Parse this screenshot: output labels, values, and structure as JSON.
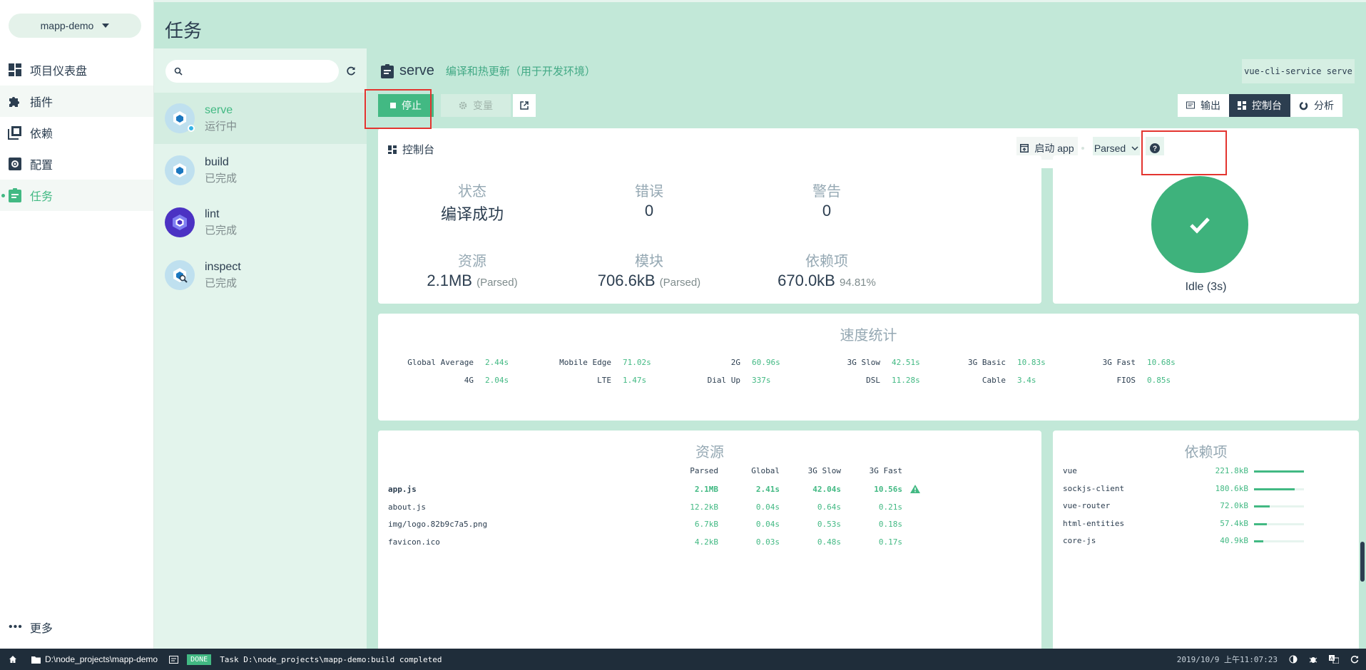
{
  "project": {
    "name": "mapp-demo"
  },
  "nav": {
    "items": [
      {
        "label": "项目仪表盘",
        "icon": "dashboard-icon"
      },
      {
        "label": "插件",
        "icon": "puzzle-icon"
      },
      {
        "label": "依赖",
        "icon": "library-icon"
      },
      {
        "label": "配置",
        "icon": "settings-icon"
      },
      {
        "label": "任务",
        "icon": "assignment-icon",
        "active": true
      }
    ],
    "more": "更多"
  },
  "header": {
    "title": "任务"
  },
  "tasks": [
    {
      "name": "serve",
      "status": "运行中",
      "selected": true
    },
    {
      "name": "build",
      "status": "已完成"
    },
    {
      "name": "lint",
      "status": "已完成"
    },
    {
      "name": "inspect",
      "status": "已完成"
    }
  ],
  "task_detail": {
    "name": "serve",
    "description": "编译和热更新（用于开发环境）",
    "command": "vue-cli-service serve",
    "stop_label": "停止",
    "vars_label": "变量",
    "views": {
      "output": "输出",
      "dashboard": "控制台",
      "analyzer": "分析"
    },
    "dashboard_title": "控制台",
    "open_app_label": "启动 app",
    "size_mode": "Parsed"
  },
  "stats": {
    "status_label": "状态",
    "status_value": "编译成功",
    "errors_label": "错误",
    "errors_value": "0",
    "warnings_label": "警告",
    "warnings_value": "0",
    "assets_label": "资源",
    "assets_value": "2.1MB",
    "assets_note": "(Parsed)",
    "modules_label": "模块",
    "modules_value": "706.6kB",
    "modules_note": "(Parsed)",
    "deps_label": "依赖项",
    "deps_value": "670.0kB",
    "deps_note": "94.81%"
  },
  "idle": {
    "label": "Idle (3s)"
  },
  "speed": {
    "title": "速度统计",
    "row1": [
      {
        "k": "Global Average",
        "v": "2.44s"
      },
      {
        "k": "Mobile Edge",
        "v": "71.02s"
      },
      {
        "k": "2G",
        "v": "60.96s"
      },
      {
        "k": "3G Slow",
        "v": "42.51s"
      },
      {
        "k": "3G Basic",
        "v": "10.83s"
      },
      {
        "k": "3G Fast",
        "v": "10.68s"
      }
    ],
    "row2": [
      {
        "k": "4G",
        "v": "2.04s"
      },
      {
        "k": "LTE",
        "v": "1.47s"
      },
      {
        "k": "Dial Up",
        "v": "337s"
      },
      {
        "k": "DSL",
        "v": "11.28s"
      },
      {
        "k": "Cable",
        "v": "3.4s"
      },
      {
        "k": "FIOS",
        "v": "0.85s"
      }
    ]
  },
  "assets": {
    "title": "资源",
    "columns": [
      "Parsed",
      "Global",
      "3G Slow",
      "3G Fast"
    ],
    "rows": [
      {
        "name": "app.js",
        "parsed": "2.1MB",
        "global": "2.41s",
        "slow": "42.04s",
        "fast": "10.56s",
        "warn": true
      },
      {
        "name": "about.js",
        "parsed": "12.2kB",
        "global": "0.04s",
        "slow": "0.64s",
        "fast": "0.21s"
      },
      {
        "name": "img/logo.82b9c7a5.png",
        "parsed": "6.7kB",
        "global": "0.04s",
        "slow": "0.53s",
        "fast": "0.18s"
      },
      {
        "name": "favicon.ico",
        "parsed": "4.2kB",
        "global": "0.03s",
        "slow": "0.48s",
        "fast": "0.17s"
      }
    ]
  },
  "dependencies": {
    "title": "依赖项",
    "rows": [
      {
        "name": "vue",
        "size": "221.8kB",
        "share": 1.0
      },
      {
        "name": "sockjs-client",
        "size": "180.6kB",
        "share": 0.81
      },
      {
        "name": "vue-router",
        "size": "72.0kB",
        "share": 0.32
      },
      {
        "name": "html-entities",
        "size": "57.4kB",
        "share": 0.26
      },
      {
        "name": "core-js",
        "size": "40.9kB",
        "share": 0.18
      }
    ]
  },
  "statusbar": {
    "path": "D:\\node_projects\\mapp-demo",
    "badge": "DONE",
    "message": "Task D:\\node_projects\\mapp-demo:build completed",
    "datetime": "2019/10/9 上午11:07:23"
  },
  "colors": {
    "accent": "#42b983",
    "dark": "#2c3e50",
    "mint": "#c2e8d8",
    "highlight": "#e3342f"
  }
}
